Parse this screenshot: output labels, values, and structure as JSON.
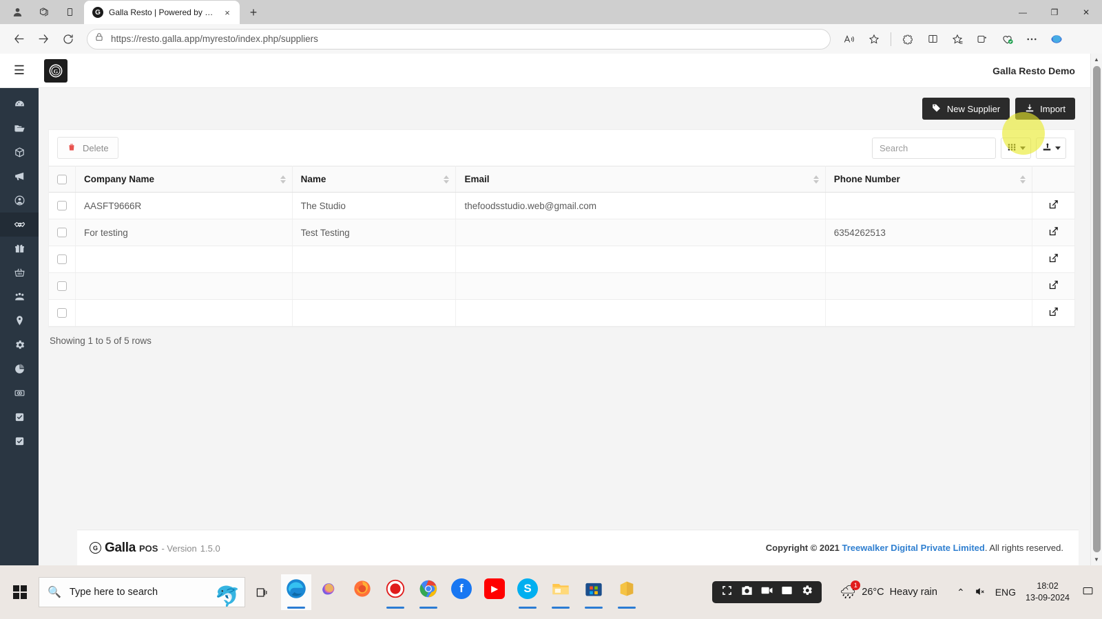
{
  "browser": {
    "tab": {
      "title": "Galla Resto | Powered by Galla",
      "favicon_letter": "G",
      "close_label": "×"
    },
    "new_tab_label": "+",
    "window_controls": {
      "minimize": "—",
      "maximize": "❐",
      "close": "✕"
    },
    "toolbar_icons": [
      "back-icon",
      "forward-icon",
      "refresh-icon"
    ],
    "url_prefix": "https://",
    "url_host": "resto.galla.app",
    "url_path": "/myresto/index.php/suppliers",
    "url_full": "https://resto.galla.app/myresto/index.php/suppliers",
    "right_icons": [
      "read-aloud-icon",
      "favorite-star-icon",
      "extensions-icon",
      "split-screen-icon",
      "collections-icon",
      "browser-essentials-icon",
      "more-options-icon",
      "copilot-icon"
    ]
  },
  "app": {
    "brand_letter": "G",
    "user_name": "Galla Resto Demo",
    "menu_toggle": "☰",
    "sidebar": [
      {
        "name": "dashboard",
        "icon": "speedometer-icon"
      },
      {
        "name": "catalog",
        "icon": "folder-open-icon"
      },
      {
        "name": "products",
        "icon": "box-icon"
      },
      {
        "name": "promotions",
        "icon": "megaphone-icon"
      },
      {
        "name": "customers",
        "icon": "user-circle-icon"
      },
      {
        "name": "suppliers",
        "icon": "handshake-icon",
        "active": true
      },
      {
        "name": "gifts",
        "icon": "gift-icon"
      },
      {
        "name": "orders",
        "icon": "basket-icon"
      },
      {
        "name": "staff",
        "icon": "people-group-icon"
      },
      {
        "name": "locations",
        "icon": "map-pin-icon"
      },
      {
        "name": "settings",
        "icon": "gear-icon"
      },
      {
        "name": "reports",
        "icon": "pie-chart-icon"
      },
      {
        "name": "payments",
        "icon": "money-icon"
      },
      {
        "name": "tasks",
        "icon": "checkbox-icon"
      },
      {
        "name": "approvals",
        "icon": "checkbox-icon"
      }
    ],
    "actions": {
      "new_supplier": "New Supplier",
      "import": "Import"
    },
    "toolbar": {
      "delete": "Delete",
      "search_placeholder": "Search",
      "columns_label": "",
      "export_label": ""
    },
    "table": {
      "columns": [
        "Company Name",
        "Name",
        "Email",
        "Phone Number"
      ],
      "rows": [
        {
          "company": "AASFT9666R",
          "name": "The Studio",
          "email": "thefoodsstudio.web@gmail.com",
          "phone": ""
        },
        {
          "company": "For testing",
          "name": "Test Testing",
          "email": "",
          "phone": "6354262513"
        },
        {
          "company": "",
          "name": "",
          "email": "",
          "phone": ""
        },
        {
          "company": "",
          "name": "",
          "email": "",
          "phone": ""
        },
        {
          "company": "",
          "name": "",
          "email": "",
          "phone": ""
        }
      ],
      "showing": "Showing 1 to 5 of 5 rows"
    },
    "footer": {
      "logo_letter": "G",
      "brand": "Galla",
      "product": "POS",
      "version_label": "- Version",
      "version_number": "1.5.0",
      "copyright_prefix": "Copyright © 2021",
      "company_link": "Treewalker Digital Private Limited",
      "copyright_suffix": ". All rights reserved."
    },
    "colors": {
      "sidebar_bg": "#2a3642",
      "button_dark": "#2b2b2b",
      "link_blue": "#2f7fd0",
      "delete_red": "#e8534f",
      "cursor_highlight": "#e9ea2a"
    }
  },
  "taskbar": {
    "search_placeholder": "Type here to search",
    "task_view": "task-view-icon",
    "apps": [
      {
        "name": "microsoft-edge",
        "glyph": "e"
      },
      {
        "name": "copilot",
        "glyph": ""
      },
      {
        "name": "firefox",
        "glyph": ""
      },
      {
        "name": "screen-recorder",
        "glyph": ""
      },
      {
        "name": "google-chrome",
        "glyph": ""
      },
      {
        "name": "facebook",
        "glyph": "f"
      },
      {
        "name": "youtube",
        "glyph": "▶"
      },
      {
        "name": "skype",
        "glyph": "S"
      },
      {
        "name": "file-explorer",
        "glyph": ""
      },
      {
        "name": "microsoft-store",
        "glyph": ""
      },
      {
        "name": "office",
        "glyph": ""
      }
    ],
    "recorder_bar": [
      "screenshot-icon",
      "camera-icon",
      "video-camera-icon",
      "window-icon",
      "settings-gear-icon"
    ],
    "weather": {
      "badge": "1",
      "temperature": "26°C",
      "description": "Heavy rain"
    },
    "system": {
      "chevron": "⌃",
      "volume": "🔇",
      "language": "ENG"
    },
    "clock": {
      "time": "18:02",
      "date": "13-09-2024"
    },
    "notification": "notification-icon"
  }
}
